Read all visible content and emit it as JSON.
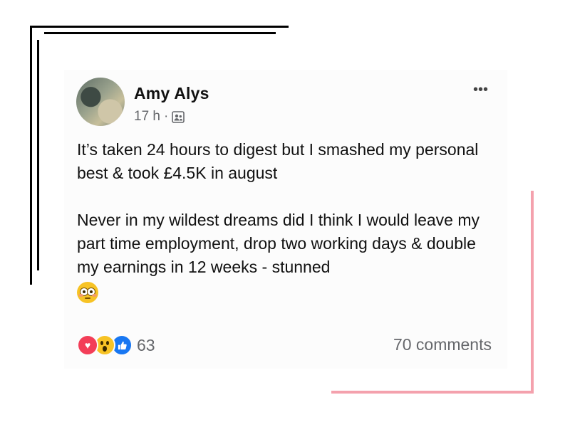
{
  "post": {
    "author": "Amy Alys",
    "time": "17 h",
    "separator": "·",
    "audience_icon": "friends-icon",
    "paragraph_1": "It’s taken 24 hours to digest but I smashed my personal best & took £4.5K in august",
    "paragraph_2": "Never in my wildest dreams did I think I would leave my part time employment, drop two working days & double my earnings in 12 weeks - stunned",
    "trailing_emoji": "flushed-face-emoji",
    "more_label": "•••"
  },
  "engagement": {
    "reactions": [
      "love",
      "wow",
      "like"
    ],
    "reaction_count": "63",
    "comments_label": "70 comments"
  },
  "colors": {
    "decor_pink": "#f4a1ad",
    "love": "#f33e58",
    "like": "#1877f2",
    "wow": "#f7c325",
    "meta_text": "#65676b"
  }
}
